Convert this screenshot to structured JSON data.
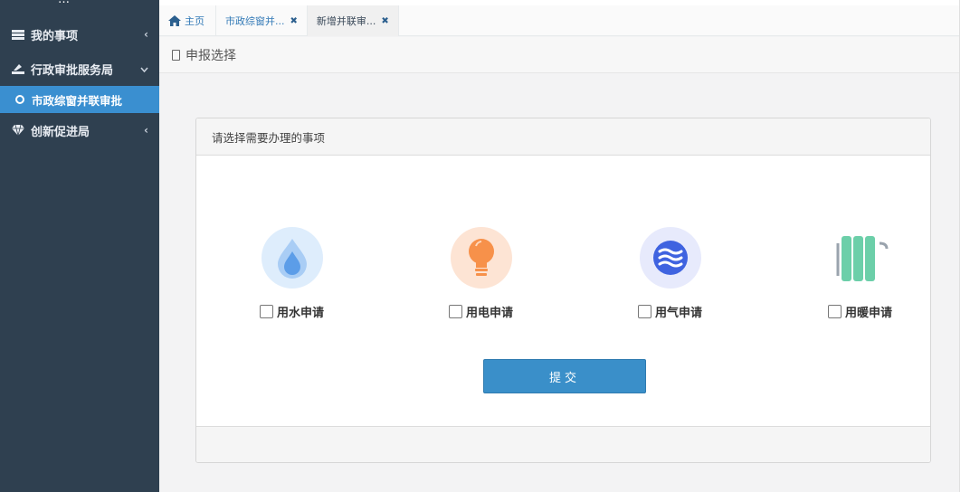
{
  "sidebar": {
    "brand": "…",
    "items": [
      {
        "label": "我的事项",
        "icon": "list-icon",
        "arrow": "‹"
      },
      {
        "label": "行政审批服务局",
        "icon": "gavel-icon",
        "arrow": "⌄"
      },
      {
        "label": "市政综窗并联审批",
        "icon": "circle-icon"
      },
      {
        "label": "创新促进局",
        "icon": "diamond-icon",
        "arrow": "‹"
      }
    ]
  },
  "tabs": [
    {
      "label": "主页",
      "icon": "home-icon"
    },
    {
      "label": "市政综窗并...",
      "close": "✖"
    },
    {
      "label": "新增并联审...",
      "close": "✖"
    }
  ],
  "page_title": "申报选择",
  "panel": {
    "header": "请选择需要办理的事项",
    "options": [
      {
        "label": "用水申请",
        "icon": "water-drop-icon",
        "bg": "#deedfc"
      },
      {
        "label": "用电申请",
        "icon": "lightbulb-icon",
        "bg": "#fde4d4"
      },
      {
        "label": "用气申请",
        "icon": "gas-wave-icon",
        "bg": "#e7eafc"
      },
      {
        "label": "用暖申请",
        "icon": "radiator-icon",
        "bg": "#ffffff"
      }
    ],
    "submit": "提交"
  },
  "colors": {
    "sidebar_bg": "#2f4050",
    "active_item": "#3a8fd0",
    "submit_bg": "#3a8fc9"
  }
}
